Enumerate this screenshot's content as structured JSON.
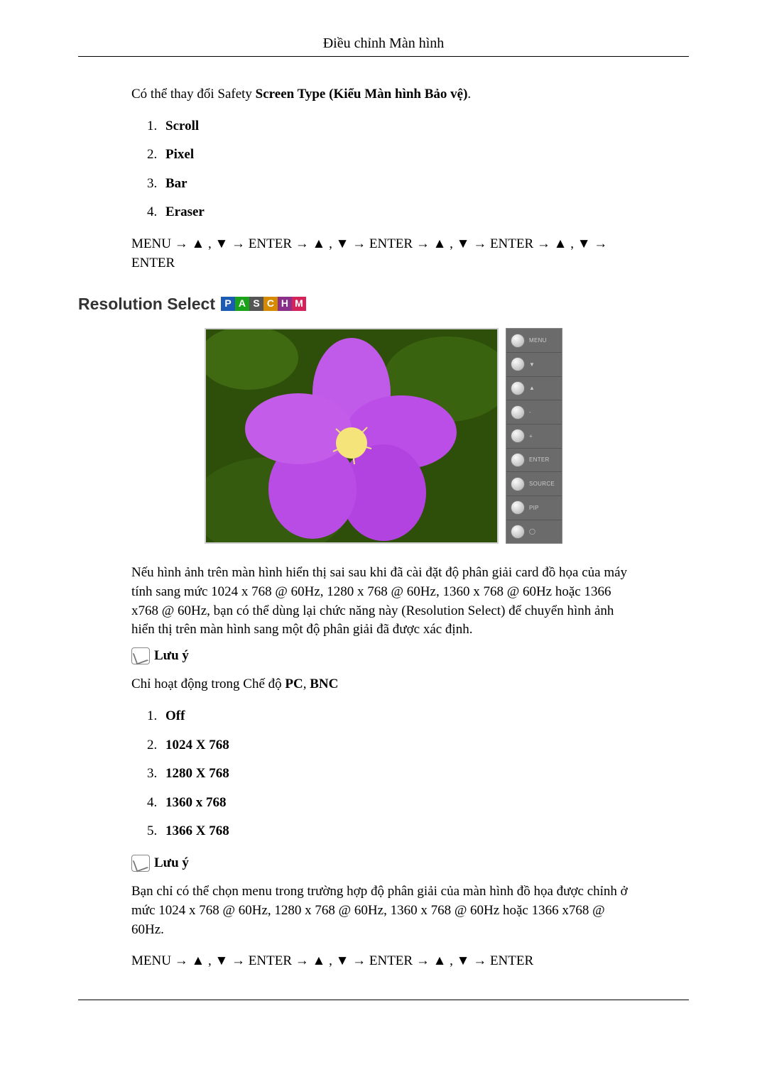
{
  "header": {
    "title": "Điều chỉnh Màn hình"
  },
  "intro": {
    "prefix": "Có thể thay đổi Safety ",
    "bold": "Screen Type (Kiểu Màn hình Bảo vệ)",
    "suffix": "."
  },
  "safety_options": [
    "Scroll",
    "Pixel",
    "Bar",
    "Eraser"
  ],
  "nav1": "MENU → ▲ , ▼ → ENTER → ▲ , ▼ → ENTER → ▲ , ▼ → ENTER → ▲ , ▼ → ENTER",
  "section": {
    "title": "Resolution Select",
    "badges": [
      "P",
      "A",
      "S",
      "C",
      "H",
      "M"
    ]
  },
  "side_buttons": [
    "MENU",
    "▼",
    "▲",
    "-",
    "+",
    "ENTER",
    "SOURCE",
    "PIP",
    "◯"
  ],
  "res_paragraph": "Nếu hình ảnh trên màn hình hiển thị sai sau khi đã cài đặt độ phân giải card đồ họa của máy tính sang mức 1024 x 768 @ 60Hz, 1280 x 768 @ 60Hz, 1360 x 768 @ 60Hz hoặc 1366 x768 @ 60Hz, bạn có thể dùng lại chức năng này (Resolution Select) để chuyển hình ảnh hiển thị trên màn hình sang một độ phân giải đã được xác định.",
  "note_label": "Lưu ý",
  "note1_text_prefix": "Chỉ hoạt động trong Chế độ ",
  "note1_text_bold1": "PC",
  "note1_text_mid": ", ",
  "note1_text_bold2": "BNC",
  "res_options": [
    "Off",
    "1024 X 768",
    "1280 X 768",
    "1360 x 768",
    "1366 X 768"
  ],
  "note2_text": "Bạn chỉ có thể chọn menu trong trường hợp độ phân giải của màn hình đồ họa được chỉnh ở mức 1024 x 768 @ 60Hz, 1280 x 768 @ 60Hz, 1360 x 768 @ 60Hz hoặc 1366 x768 @ 60Hz.",
  "nav2": "MENU → ▲ , ▼ → ENTER → ▲ , ▼ → ENTER → ▲ , ▼ → ENTER"
}
